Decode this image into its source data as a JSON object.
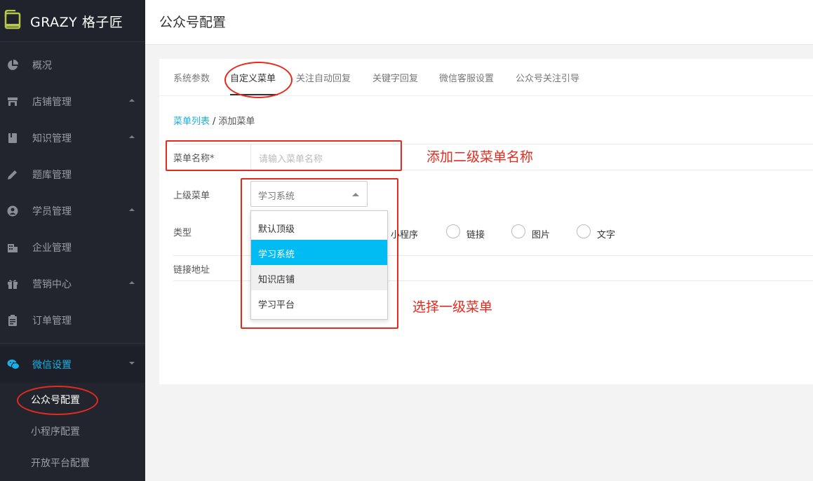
{
  "app": {
    "brand_latin": "GRAZY",
    "brand_cn": "格子匠"
  },
  "header": {
    "page_title": "公众号配置"
  },
  "sidebar": {
    "items": [
      {
        "label": "概况",
        "icon": "pie-chart-icon"
      },
      {
        "label": "店铺管理",
        "icon": "store-icon",
        "has_caret": true
      },
      {
        "label": "知识管理",
        "icon": "book-icon",
        "has_caret": true
      },
      {
        "label": "题库管理",
        "icon": "pencil-icon"
      },
      {
        "label": "学员管理",
        "icon": "user-icon",
        "has_caret": true
      },
      {
        "label": "企业管理",
        "icon": "building-icon"
      },
      {
        "label": "营销中心",
        "icon": "gift-icon",
        "has_caret": true
      },
      {
        "label": "订单管理",
        "icon": "clipboard-icon"
      },
      {
        "label": "微信设置",
        "icon": "wechat-icon",
        "has_caret": true,
        "active": true
      }
    ],
    "sub_items": [
      {
        "label": "公众号配置",
        "active": true
      },
      {
        "label": "小程序配置"
      },
      {
        "label": "开放平台配置"
      }
    ]
  },
  "tabs": [
    {
      "label": "系统参数"
    },
    {
      "label": "自定义菜单",
      "active": true
    },
    {
      "label": "关注自动回复"
    },
    {
      "label": "关键字回复"
    },
    {
      "label": "微信客服设置"
    },
    {
      "label": "公众号关注引导"
    }
  ],
  "breadcrumb": {
    "link": "菜单列表",
    "separator": "/",
    "current": "添加菜单"
  },
  "form": {
    "name_label": "菜单名称*",
    "name_placeholder": "请输入菜单名称",
    "parent_label": "上级菜单",
    "parent_value": "学习系统",
    "parent_options": [
      "默认顶级",
      "学习系统",
      "知识店铺",
      "学习平台"
    ],
    "type_label": "类型",
    "type_options": [
      "小程序",
      "链接",
      "图片",
      "文字"
    ],
    "url_label": "链接地址"
  },
  "annotations": {
    "add_name_note": "添加二级菜单名称",
    "select_parent_note": "选择一级菜单",
    "color": "#e52b1e"
  },
  "colors": {
    "accent": "#1ab0e6",
    "dropdown_selected": "#00bcf2",
    "sidebar_bg": "#22252e"
  }
}
